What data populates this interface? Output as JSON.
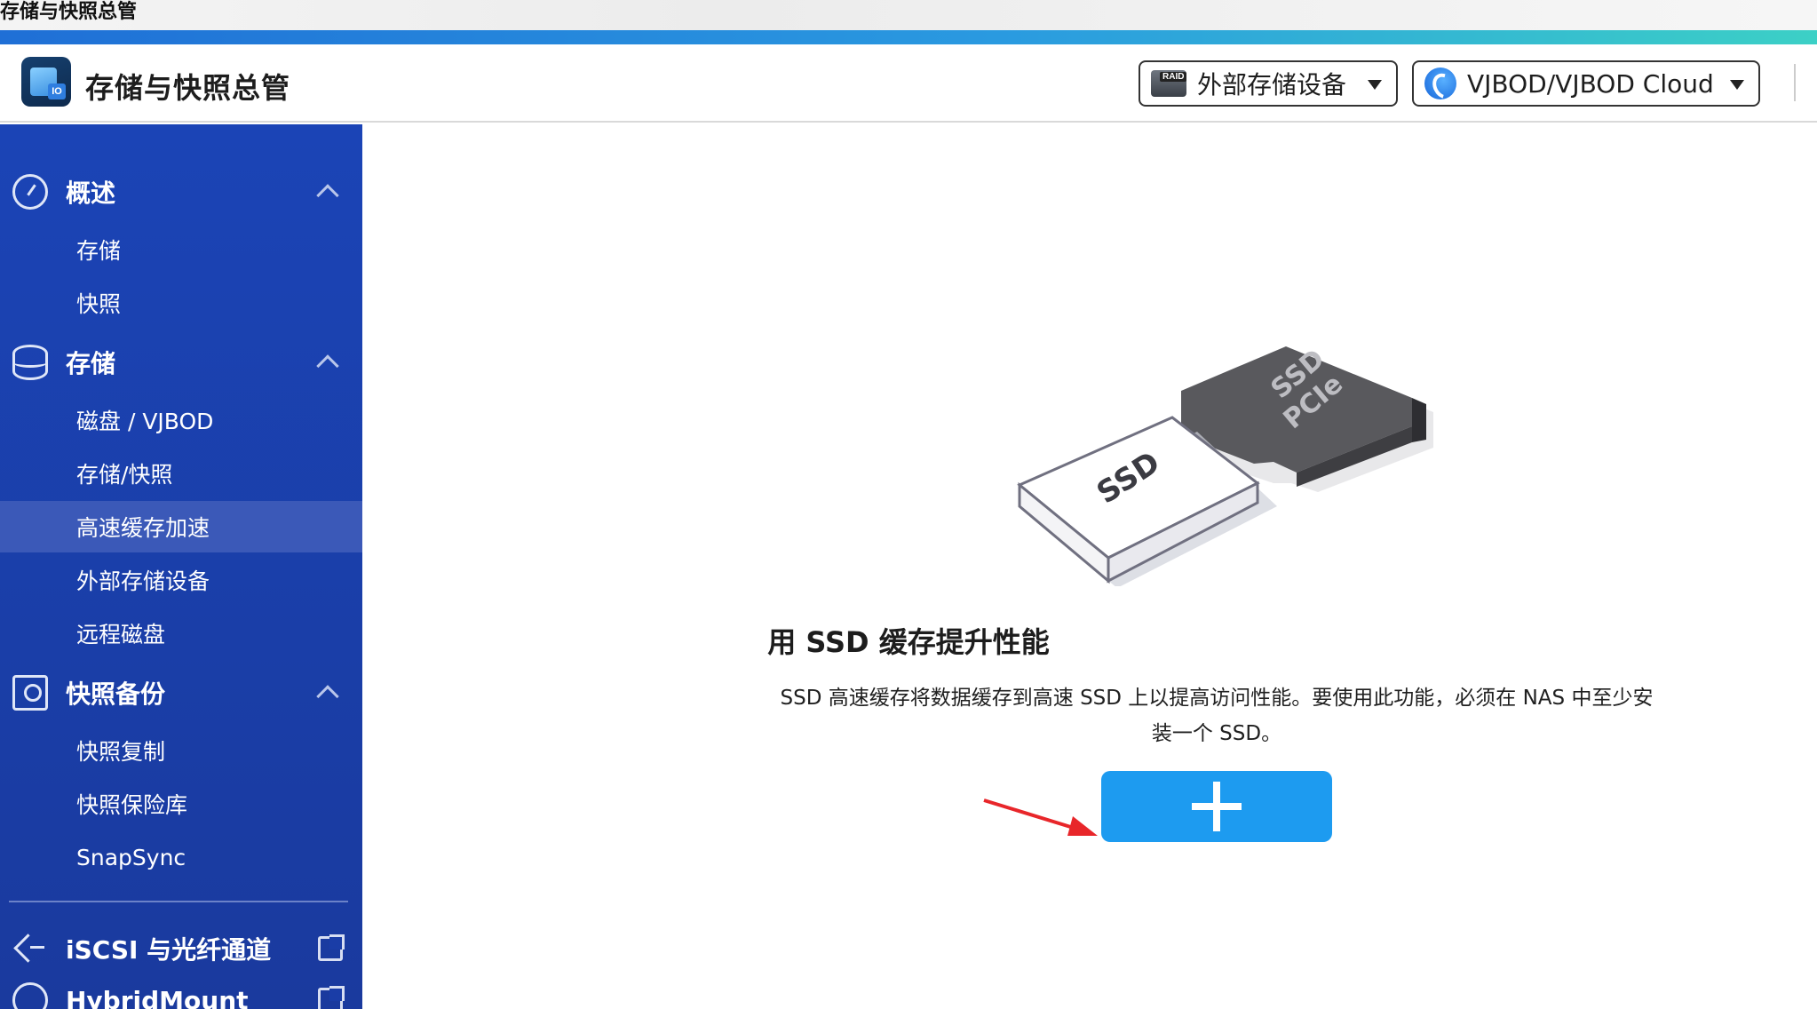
{
  "window": {
    "title": "存储与快照总管"
  },
  "header": {
    "app_title": "存储与快照总管",
    "dropdown_external": {
      "label": "外部存储设备",
      "icon_badge": "RAID"
    },
    "dropdown_vjbod": {
      "label": "VJBOD/VJBOD Cloud"
    }
  },
  "sidebar": {
    "overview": {
      "label": "概述",
      "items": [
        "存储",
        "快照"
      ]
    },
    "storage": {
      "label": "存储",
      "items": [
        "磁盘 / VJBOD",
        "存储/快照",
        "高速缓存加速",
        "外部存储设备",
        "远程磁盘"
      ],
      "active": "高速缓存加速"
    },
    "snapshot_backup": {
      "label": "快照备份",
      "items": [
        "快照复制",
        "快照保险库",
        "SnapSync"
      ]
    },
    "iscsi": {
      "label": "iSCSI 与光纤通道"
    },
    "hybridmount": {
      "label": "HybridMount"
    }
  },
  "main": {
    "illustration": {
      "ssd_label": "SSD",
      "pcie_label_1": "SSD",
      "pcie_label_2": "PCIe"
    },
    "heading": "用 SSD 缓存提升性能",
    "description": "SSD 高速缓存将数据缓存到高速 SSD 上以提高访问性能。要使用此功能，必须在 NAS 中至少安装一个 SSD。",
    "add_button": {
      "icon": "plus-icon"
    }
  },
  "colors": {
    "sidebar_bg": "#1b44b6",
    "active_item": "#3b59b8",
    "button": "#1d9bf0",
    "arrow": "#e8262a"
  }
}
